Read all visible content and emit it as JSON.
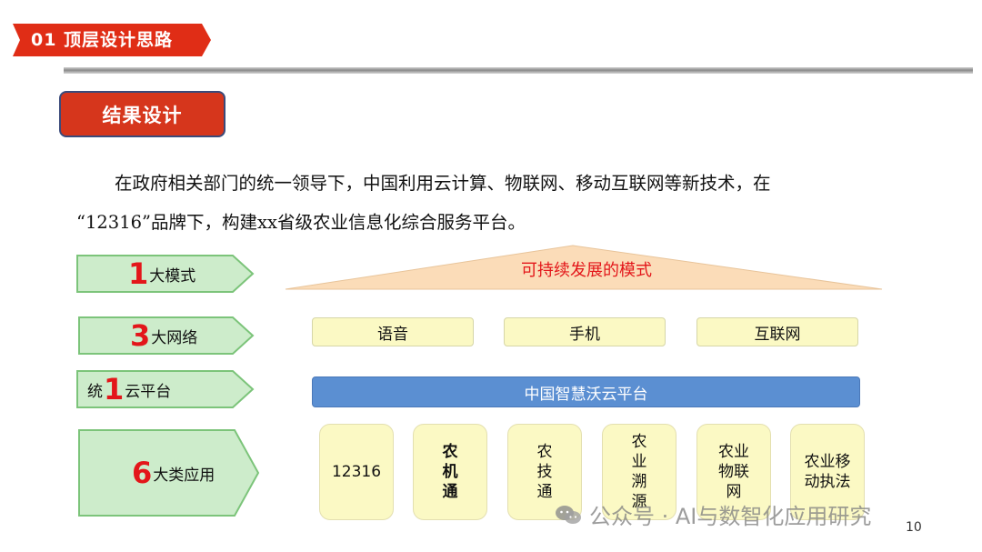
{
  "header": {
    "title": "01  顶层设计思路",
    "accent_color": "#e02d16"
  },
  "section": {
    "label": "结果设计"
  },
  "intro": {
    "line1": "在政府相关部门的统一领导下，中国利用云计算、物联网、移动互联网等新技术，在",
    "line2": "“12316”品牌下，构建xx省级农业信息化综合服务平台。"
  },
  "left_labels": [
    {
      "prefix": "",
      "num": "1",
      "suffix": "大模式"
    },
    {
      "prefix": "",
      "num": "3",
      "suffix": "大网络"
    },
    {
      "prefix": "统",
      "num": "1",
      "suffix": "云平台"
    },
    {
      "prefix": "",
      "num": "6",
      "suffix": "大类应用"
    }
  ],
  "mode": {
    "label": "可持续发展的模式"
  },
  "networks": [
    "语音",
    "手机",
    "互联网"
  ],
  "cloud": {
    "label": "中国智慧沃云平台"
  },
  "apps": [
    "12316",
    "农\n机\n通",
    "农\n技\n通",
    "农\n业\n溯\n源",
    "农业\n物联\n网",
    "农业移\n动执法"
  ],
  "watermark": {
    "text": "公众号 · AI与数智化应用研究",
    "icon": "wechat-icon"
  },
  "page_number": "10",
  "colors": {
    "arrow_fill": "#cdeccb",
    "arrow_border": "#7cc47a",
    "number_red": "#e3161a",
    "cloud_blue": "#5b8fd2",
    "box_yellow": "#fbf9c4",
    "triangle_fill": "#fbdcb8"
  }
}
